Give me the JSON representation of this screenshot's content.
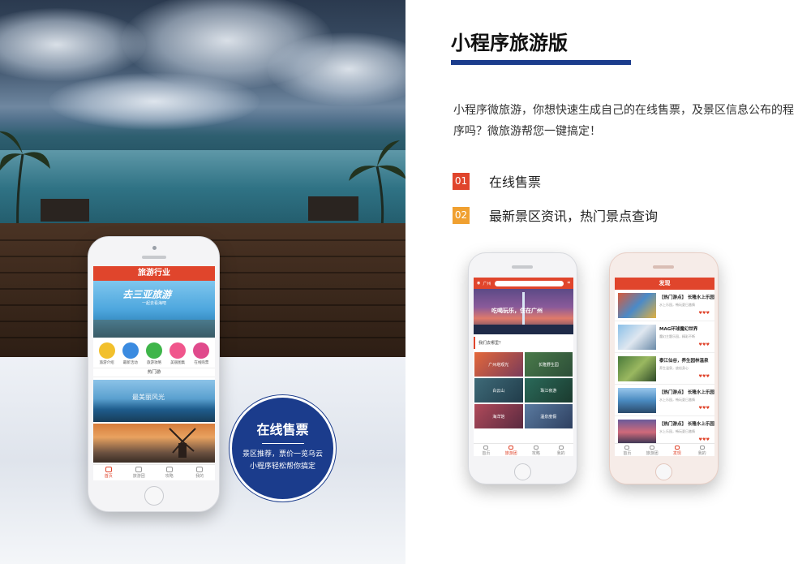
{
  "heading": "小程序旅游版",
  "description": "小程序微旅游，你想快速生成自己的在线售票，及景区信息公布的程序吗？微旅游帮您一键搞定！",
  "features": [
    {
      "num": "01",
      "text": "在线售票",
      "color": "#e0452c"
    },
    {
      "num": "02",
      "text": "最新景区资讯，热门景点查询",
      "color": "#f0a030"
    }
  ],
  "circle": {
    "title": "在线售票",
    "line1": "景区推荐，票价一览乌云",
    "line2": "小程序轻松帮你搞定"
  },
  "phone_main": {
    "appbar": "旅游行业",
    "banner_text": "去三亚旅游",
    "banner_sub": "一起去看海吧",
    "icons": [
      {
        "label": "旅游介绍",
        "color": "#f2c02c"
      },
      {
        "label": "最新活动",
        "color": "#3b8be0"
      },
      {
        "label": "旅游攻略",
        "color": "#3fb54a"
      },
      {
        "label": "美丽图集",
        "color": "#f0568c"
      },
      {
        "label": "在线购票",
        "color": "#e04a8c"
      }
    ],
    "section": "热门游",
    "cards": [
      {
        "label": "最美丽风光"
      },
      {
        "label": ""
      }
    ],
    "tabs": [
      "首页",
      "旅游团",
      "攻略",
      "我的"
    ]
  },
  "phone_guangzhou": {
    "city": "广州",
    "banner_text": "吃喝玩乐，住在广州",
    "section": "我们去哪里？",
    "cells": [
      "广州塔观光",
      "长隆野生园",
      "白云山",
      "珠江夜游",
      "海洋馆",
      "温泉度假"
    ],
    "tabs": [
      "首页",
      "旅游团",
      "攻略",
      "我的"
    ]
  },
  "phone_discover": {
    "appbar": "发现",
    "items": [
      {
        "title": "【热门游点】 长隆水上乐园",
        "desc": "水上乐园，畅玩夏日激情"
      },
      {
        "title": "MAG环球魔幻世界",
        "desc": "魔幻主题乐园，精彩不断"
      },
      {
        "title": "泰江仙谷，养生园林温泉",
        "desc": "养生温泉，放松身心"
      },
      {
        "title": "【热门游点】 长隆水上乐园",
        "desc": "水上乐园，畅玩夏日激情"
      },
      {
        "title": "【热门游点】 长隆水上乐园",
        "desc": "水上乐园，畅玩夏日激情"
      }
    ],
    "tabs": [
      "首页",
      "旅游团",
      "发现",
      "我的"
    ]
  }
}
